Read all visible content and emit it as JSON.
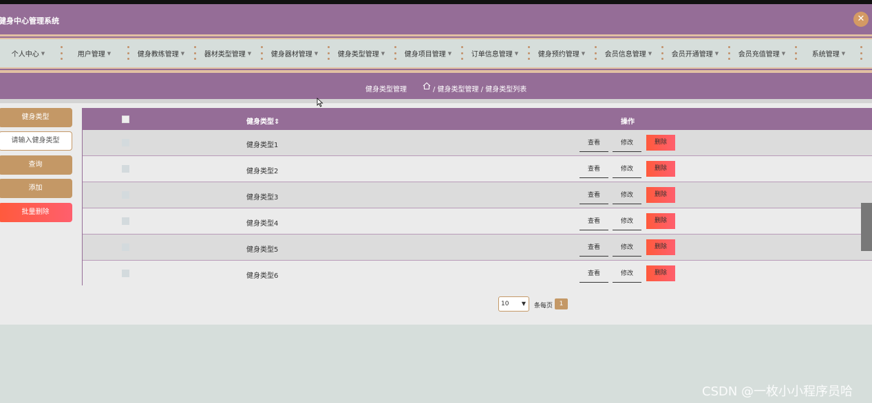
{
  "app": {
    "title": "健身中心管理系统",
    "close_icon": "close-x-icon",
    "accent": "#956d97",
    "gold": "#c49866"
  },
  "nav": {
    "items": [
      {
        "label": "个人中心"
      },
      {
        "label": "用户管理"
      },
      {
        "label": "健身教练管理"
      },
      {
        "label": "器材类型管理"
      },
      {
        "label": "健身器材管理"
      },
      {
        "label": "健身类型管理"
      },
      {
        "label": "健身项目管理"
      },
      {
        "label": "订单信息管理"
      },
      {
        "label": "健身预约管理"
      },
      {
        "label": "会员信息管理"
      },
      {
        "label": "会员开通管理"
      },
      {
        "label": "会员充值管理"
      },
      {
        "label": "系统管理"
      }
    ]
  },
  "breadcrumb": {
    "title": "健身类型管理",
    "path": "/ 健身类型管理 / 健身类型列表",
    "home_icon": "home-icon"
  },
  "sidebar": {
    "label": "健身类型",
    "input_placeholder": "请输入健身类型",
    "query": "查询",
    "add": "添加",
    "batch_delete": "批量删除"
  },
  "table": {
    "headers": {
      "type": "健身类型",
      "sort_icon": "sort-icon",
      "ops": "操作"
    },
    "rows": [
      {
        "name": "健身类型1"
      },
      {
        "name": "健身类型2"
      },
      {
        "name": "健身类型3"
      },
      {
        "name": "健身类型4"
      },
      {
        "name": "健身类型5"
      },
      {
        "name": "健身类型6"
      }
    ],
    "actions": {
      "view": "查看",
      "edit": "修改",
      "delete": "删除"
    }
  },
  "pager": {
    "page_size": "10",
    "per_page_text": "条每页",
    "current_page": "1"
  },
  "watermark": "CSDN @一枚小小程序员哈"
}
